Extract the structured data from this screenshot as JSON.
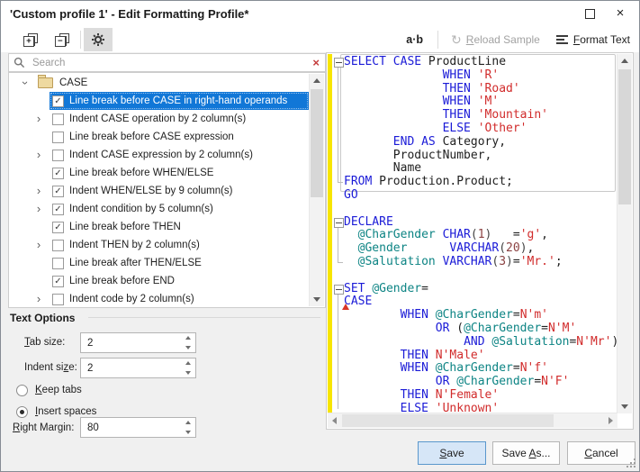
{
  "window": {
    "title": "'Custom profile 1' - Edit Formatting Profile*"
  },
  "icons": {
    "close": "×",
    "clear": "×",
    "chevron": "›",
    "check": "✓",
    "reload": "↻",
    "expand_all_glyph": "+",
    "collapse_all_glyph": "−"
  },
  "search": {
    "placeholder": "Search"
  },
  "tree": {
    "root": {
      "label": "CASE"
    },
    "items": [
      {
        "label": "Line break before CASE in right-hand operands",
        "checked": true,
        "selected": true,
        "expandable": false
      },
      {
        "label": "Indent CASE operation by 2 column(s)",
        "checked": false,
        "selected": false,
        "expandable": true
      },
      {
        "label": "Line break before CASE expression",
        "checked": false,
        "selected": false,
        "expandable": false
      },
      {
        "label": "Indent CASE expression by 2 column(s)",
        "checked": false,
        "selected": false,
        "expandable": true
      },
      {
        "label": "Line break before WHEN/ELSE",
        "checked": true,
        "selected": false,
        "expandable": false
      },
      {
        "label": "Indent WHEN/ELSE by 9 column(s)",
        "checked": true,
        "selected": false,
        "expandable": true
      },
      {
        "label": "Indent condition by 5 column(s)",
        "checked": true,
        "selected": false,
        "expandable": true
      },
      {
        "label": "Line break before THEN",
        "checked": true,
        "selected": false,
        "expandable": false
      },
      {
        "label": "Indent THEN by 2 column(s)",
        "checked": false,
        "selected": false,
        "expandable": true
      },
      {
        "label": "Line break after THEN/ELSE",
        "checked": false,
        "selected": false,
        "expandable": false
      },
      {
        "label": "Line break before END",
        "checked": true,
        "selected": false,
        "expandable": false
      },
      {
        "label": "Indent code by 2 column(s)",
        "checked": false,
        "selected": false,
        "expandable": true
      }
    ]
  },
  "text_options": {
    "title": "Text Options",
    "tab_size": {
      "key": "T",
      "post": "ab size:",
      "value": "2"
    },
    "indent_size": {
      "pre": "Indent si",
      "key": "z",
      "post": "e:",
      "value": "2"
    },
    "keep_tabs": {
      "key": "K",
      "post": "eep tabs",
      "selected": false
    },
    "insert_spaces": {
      "key": "I",
      "post": "nsert spaces",
      "selected": true
    },
    "right_margin": {
      "key": "R",
      "post": "ight Margin:",
      "value": "80"
    }
  },
  "right_toolbar": {
    "ab_label": "a·b",
    "reload": {
      "key": "R",
      "post": "eload Sample",
      "disabled": true
    },
    "format": {
      "key": "F",
      "post": "ormat Text"
    }
  },
  "buttons": {
    "save": {
      "key": "S",
      "post": "ave",
      "default": true
    },
    "save_as": {
      "pre": "Save ",
      "key": "A",
      "post": "s..."
    },
    "cancel": {
      "key": "C",
      "post": "ancel"
    }
  },
  "editor": {
    "lines": [
      [
        [
          "k",
          "SELECT"
        ],
        [
          "t",
          " "
        ],
        [
          "k",
          "CASE"
        ],
        [
          "t",
          " ProductLine"
        ]
      ],
      [
        [
          "t",
          "              "
        ],
        [
          "k",
          "WHEN"
        ],
        [
          "t",
          " "
        ],
        [
          "s",
          "'R'"
        ]
      ],
      [
        [
          "t",
          "              "
        ],
        [
          "k",
          "THEN"
        ],
        [
          "t",
          " "
        ],
        [
          "s",
          "'Road'"
        ]
      ],
      [
        [
          "t",
          "              "
        ],
        [
          "k",
          "WHEN"
        ],
        [
          "t",
          " "
        ],
        [
          "s",
          "'M'"
        ]
      ],
      [
        [
          "t",
          "              "
        ],
        [
          "k",
          "THEN"
        ],
        [
          "t",
          " "
        ],
        [
          "s",
          "'Mountain'"
        ]
      ],
      [
        [
          "t",
          "              "
        ],
        [
          "k",
          "ELSE"
        ],
        [
          "t",
          " "
        ],
        [
          "s",
          "'Other'"
        ]
      ],
      [
        [
          "t",
          "       "
        ],
        [
          "k",
          "END"
        ],
        [
          "t",
          " "
        ],
        [
          "k",
          "AS"
        ],
        [
          "t",
          " Category,"
        ]
      ],
      [
        [
          "t",
          "       ProductNumber,"
        ]
      ],
      [
        [
          "t",
          "       Name"
        ]
      ],
      [
        [
          "k",
          "FROM"
        ],
        [
          "t",
          " Production.Product;"
        ]
      ],
      [
        [
          "k",
          "GO"
        ]
      ],
      [],
      [
        [
          "k",
          "DECLARE"
        ]
      ],
      [
        [
          "t",
          "  "
        ],
        [
          "v",
          "@CharGender"
        ],
        [
          "t",
          " "
        ],
        [
          "k",
          "CHAR"
        ],
        [
          "o",
          "("
        ],
        [
          "n",
          "1"
        ],
        [
          "o",
          ")"
        ],
        [
          "t",
          "   ="
        ],
        [
          "s",
          "'g'"
        ],
        [
          "t",
          ","
        ]
      ],
      [
        [
          "t",
          "  "
        ],
        [
          "v",
          "@Gender"
        ],
        [
          "t",
          "      "
        ],
        [
          "k",
          "VARCHAR"
        ],
        [
          "o",
          "("
        ],
        [
          "n",
          "20"
        ],
        [
          "o",
          ")"
        ],
        [
          "t",
          ","
        ]
      ],
      [
        [
          "t",
          "  "
        ],
        [
          "v",
          "@Salutation"
        ],
        [
          "t",
          " "
        ],
        [
          "k",
          "VARCHAR"
        ],
        [
          "o",
          "("
        ],
        [
          "n",
          "3"
        ],
        [
          "o",
          ")"
        ],
        [
          "t",
          "="
        ],
        [
          "s",
          "'Mr.'"
        ],
        [
          "t",
          ";"
        ]
      ],
      [],
      [
        [
          "k",
          "SET"
        ],
        [
          "t",
          " "
        ],
        [
          "v",
          "@Gender"
        ],
        [
          "t",
          "="
        ]
      ],
      [
        [
          "k",
          "CASE"
        ]
      ],
      [
        [
          "t",
          "        "
        ],
        [
          "k",
          "WHEN"
        ],
        [
          "t",
          " "
        ],
        [
          "v",
          "@CharGender"
        ],
        [
          "t",
          "="
        ],
        [
          "s",
          "N'm'"
        ]
      ],
      [
        [
          "t",
          "             "
        ],
        [
          "k",
          "OR"
        ],
        [
          "t",
          " ("
        ],
        [
          "v",
          "@CharGender"
        ],
        [
          "t",
          "="
        ],
        [
          "s",
          "N'M'"
        ]
      ],
      [
        [
          "t",
          "                 "
        ],
        [
          "k",
          "AND"
        ],
        [
          "t",
          " "
        ],
        [
          "v",
          "@Salutation"
        ],
        [
          "t",
          "="
        ],
        [
          "s",
          "N'Mr'"
        ],
        [
          "t",
          ")"
        ]
      ],
      [
        [
          "t",
          "        "
        ],
        [
          "k",
          "THEN"
        ],
        [
          "t",
          " "
        ],
        [
          "s",
          "N'Male'"
        ]
      ],
      [
        [
          "t",
          "        "
        ],
        [
          "k",
          "WHEN"
        ],
        [
          "t",
          " "
        ],
        [
          "v",
          "@CharGender"
        ],
        [
          "t",
          "="
        ],
        [
          "s",
          "N'f'"
        ]
      ],
      [
        [
          "t",
          "             "
        ],
        [
          "k",
          "OR"
        ],
        [
          "t",
          " "
        ],
        [
          "v",
          "@CharGender"
        ],
        [
          "t",
          "="
        ],
        [
          "s",
          "N'F'"
        ]
      ],
      [
        [
          "t",
          "        "
        ],
        [
          "k",
          "THEN"
        ],
        [
          "t",
          " "
        ],
        [
          "s",
          "N'Female'"
        ]
      ],
      [
        [
          "t",
          "        "
        ],
        [
          "k",
          "ELSE"
        ],
        [
          "t",
          " "
        ],
        [
          "s",
          "'Unknown'"
        ]
      ]
    ],
    "statement_box": {
      "start": 0,
      "end": 9
    },
    "folds": [
      {
        "start": 0,
        "end": 9,
        "tail": true
      },
      {
        "start": 12,
        "end": 15,
        "tail": true
      },
      {
        "start": 17,
        "end": 26,
        "tail": false
      }
    ],
    "error_marker_line": 18
  },
  "colors": {
    "accent": "#1177d7",
    "selected_text": "#ffffff",
    "changed_lines_bar": "#f7e500",
    "save_button_fill": "#d6e6f7",
    "save_button_border": "#5a97cc",
    "syntax": {
      "keyword": "#1b1bd7",
      "string": "#d12b2b",
      "variable": "#0d8484",
      "number": "#8b4242",
      "text": "#1f1f1f",
      "punctuation": "#444444"
    }
  }
}
